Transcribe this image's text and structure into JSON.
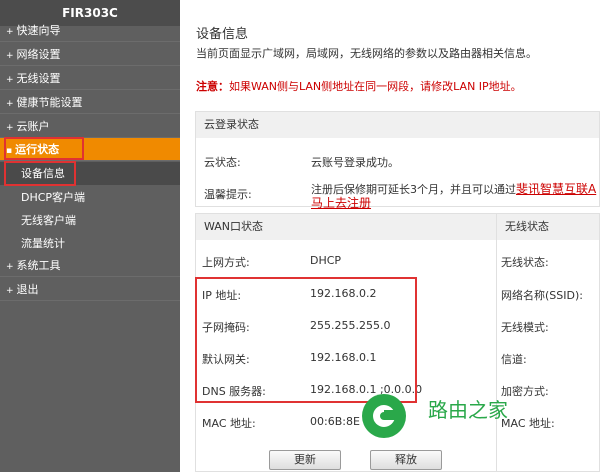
{
  "sidebar": {
    "title": "FIR303C",
    "menu": [
      {
        "label": "快速向导"
      },
      {
        "label": "网络设置"
      },
      {
        "label": "无线设置"
      },
      {
        "label": "健康节能设置"
      },
      {
        "label": "云账户"
      },
      {
        "label": "运行状态"
      },
      {
        "label": "系统工具"
      },
      {
        "label": "退出"
      }
    ],
    "submenu": [
      {
        "label": "设备信息"
      },
      {
        "label": "DHCP客户端"
      },
      {
        "label": "无线客户端"
      },
      {
        "label": "流量统计"
      }
    ]
  },
  "main": {
    "title": "设备信息",
    "description": "当前页面显示广域网，局域网，无线网络的参数以及路由器相关信息。",
    "notice_prefix": "注意：",
    "notice_text": "如果WAN侧与LAN侧地址在同一网段，请修改LAN IP地址。",
    "cloud": {
      "heading": "云登录状态",
      "status_label": "云状态:",
      "status_value": "云账号登录成功。",
      "tip_label": "温馨提示:",
      "tip_text": "注册后保修期可延长3个月，并且可以通过",
      "tip_link": "斐讯智慧互联A",
      "tip_link2": "马上去注册"
    },
    "wan": {
      "heading": "WAN口状态",
      "rows": [
        {
          "label": "上网方式:",
          "value": "DHCP"
        },
        {
          "label": "IP 地址:",
          "value": "192.168.0.2"
        },
        {
          "label": "子网掩码:",
          "value": "255.255.255.0"
        },
        {
          "label": "默认网关:",
          "value": "192.168.0.1"
        },
        {
          "label": "DNS 服务器:",
          "value": "192.168.0.1 ;0.0.0.0"
        },
        {
          "label": "MAC 地址:",
          "value": "00:6B:8E"
        }
      ]
    },
    "wireless": {
      "heading": "无线状态",
      "rows": [
        {
          "label": "无线状态:"
        },
        {
          "label": "网络名称(SSID):"
        },
        {
          "label": "无线模式:"
        },
        {
          "label": "信道:"
        },
        {
          "label": "加密方式:"
        },
        {
          "label": "MAC 地址:"
        }
      ]
    },
    "buttons": {
      "renew": "更新",
      "release": "释放"
    },
    "watermark": "路由之家"
  }
}
